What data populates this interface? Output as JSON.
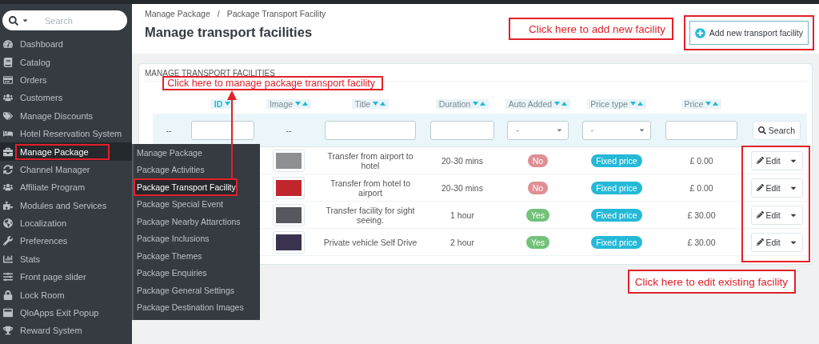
{
  "sidebar": {
    "search": {
      "placeholder": "Search"
    },
    "items": [
      {
        "label": "Dashboard",
        "selected": false,
        "highlighted": false
      },
      {
        "label": "Catalog",
        "selected": false,
        "highlighted": false
      },
      {
        "label": "Orders",
        "selected": false,
        "highlighted": false
      },
      {
        "label": "Customers",
        "selected": false,
        "highlighted": false
      },
      {
        "label": "Manage Discounts",
        "selected": false,
        "highlighted": false
      },
      {
        "label": "Hotel Reservation System",
        "selected": false,
        "highlighted": false
      },
      {
        "label": "Manage Package",
        "selected": true,
        "highlighted": true
      },
      {
        "label": "Channel Manager",
        "selected": false,
        "highlighted": false
      },
      {
        "label": "Affiliate Program",
        "selected": false,
        "highlighted": false
      },
      {
        "label": "Modules and Services",
        "selected": false,
        "highlighted": false
      },
      {
        "label": "Localization",
        "selected": false,
        "highlighted": false
      },
      {
        "label": "Preferences",
        "selected": false,
        "highlighted": false
      },
      {
        "label": "Stats",
        "selected": false,
        "highlighted": false
      },
      {
        "label": "Front page slider",
        "selected": false,
        "highlighted": false
      },
      {
        "label": "Lock Room",
        "selected": false,
        "highlighted": false
      },
      {
        "label": "QloApps Exit Popup",
        "selected": false,
        "highlighted": false
      },
      {
        "label": "Reward System",
        "selected": false,
        "highlighted": false
      }
    ]
  },
  "submenu": {
    "items": [
      {
        "label": "Manage Package",
        "selected": false,
        "highlighted": false
      },
      {
        "label": "Package Activities",
        "selected": false,
        "highlighted": false
      },
      {
        "label": "Package Transport Facility",
        "selected": true,
        "highlighted": true
      },
      {
        "label": "Package Special Event",
        "selected": false,
        "highlighted": false
      },
      {
        "label": "Package Nearby Attarctions",
        "selected": false,
        "highlighted": false
      },
      {
        "label": "Package Inclusions",
        "selected": false,
        "highlighted": false
      },
      {
        "label": "Package Themes",
        "selected": false,
        "highlighted": false
      },
      {
        "label": "Package Enquiries",
        "selected": false,
        "highlighted": false
      },
      {
        "label": "Package General Settings",
        "selected": false,
        "highlighted": false
      },
      {
        "label": "Package Destination Images",
        "selected": false,
        "highlighted": false
      }
    ]
  },
  "header": {
    "breadcrumb": [
      "Manage Package",
      "Package Transport Facility"
    ],
    "breadcrumb_separator": "/",
    "title": "Manage transport facilities",
    "add_button": {
      "label": "Add new transport facility",
      "highlighted": true
    }
  },
  "panel": {
    "title": "MANAGE TRANSPORT FACILITIES",
    "table": {
      "columns": [
        {
          "label": "ID",
          "sorted": true
        },
        {
          "label": "Image",
          "sorted": false
        },
        {
          "label": "Title",
          "sorted": false
        },
        {
          "label": "Duration",
          "sorted": false
        },
        {
          "label": "Auto Added",
          "sorted": false
        },
        {
          "label": "Price type",
          "sorted": false
        },
        {
          "label": "Price",
          "sorted": false
        }
      ],
      "filters": [
        {
          "kind": "dash",
          "text": "--"
        },
        {
          "kind": "text"
        },
        {
          "kind": "dash",
          "text": "--"
        },
        {
          "kind": "text"
        },
        {
          "kind": "text"
        },
        {
          "kind": "select",
          "value": "-"
        },
        {
          "kind": "select",
          "value": "-"
        },
        {
          "kind": "text"
        },
        {
          "kind": "button",
          "label": "Search"
        }
      ],
      "actions_highlighted": true,
      "rows": [
        {
          "title": "Transfer from airport to hotel",
          "duration": "20-30 mins",
          "auto_added": {
            "text": "No",
            "kind": "no"
          },
          "price_type": "Fixed price",
          "price": "£ 0.00",
          "action": "Edit"
        },
        {
          "title": "Transfer from hotel to airport",
          "duration": "20-30 mins",
          "auto_added": {
            "text": "No",
            "kind": "no"
          },
          "price_type": "Fixed price",
          "price": "£ 0.00",
          "action": "Edit"
        },
        {
          "title": "Transfer facility for sight seeing.",
          "duration": "1 hour",
          "auto_added": {
            "text": "Yes",
            "kind": "yes"
          },
          "price_type": "Fixed price",
          "price": "£ 30.00",
          "action": "Edit"
        },
        {
          "title": "Private vehicle Self Drive",
          "duration": "2 hour",
          "auto_added": {
            "text": "Yes",
            "kind": "yes"
          },
          "price_type": "Fixed price",
          "price": "£ 30.00",
          "action": "Edit"
        }
      ]
    }
  },
  "annotations": [
    {
      "text": "Click here to add new facility"
    },
    {
      "text": "Click here to manage package transport facility"
    },
    {
      "text": "Click here to edit existing facility"
    }
  ]
}
